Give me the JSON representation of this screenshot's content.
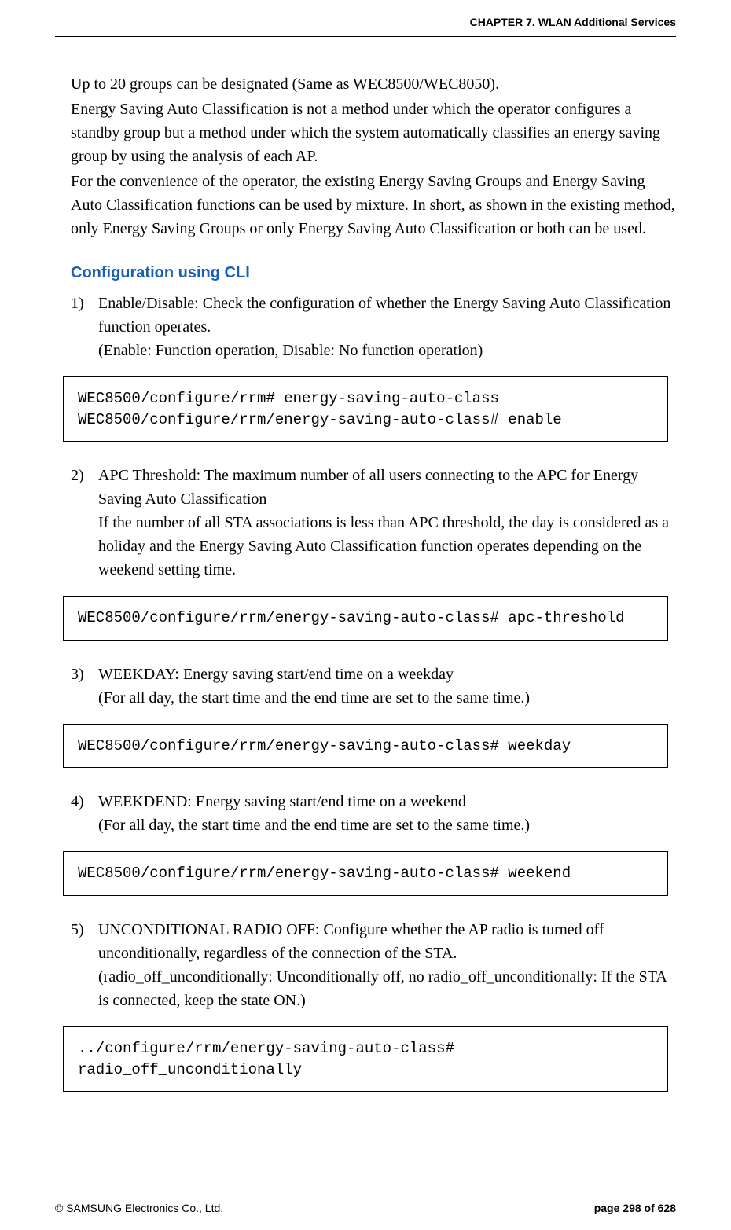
{
  "header": {
    "chapter": "CHAPTER 7. WLAN Additional Services"
  },
  "intro": {
    "para1": "Up to 20 groups can be designated (Same as WEC8500/WEC8050).",
    "para2": "Energy Saving Auto Classification is not a method under which the operator configures a standby group but a method under which the system automatically classifies an energy saving group by using the analysis of each AP.",
    "para3": "For the convenience of the operator, the existing Energy Saving Groups and Energy Saving Auto Classification functions can be used by mixture. In short, as shown in the existing method, only Energy Saving Groups or only Energy Saving Auto Classification or both can be used."
  },
  "section": {
    "title": "Configuration using CLI"
  },
  "items": [
    {
      "num": "1)",
      "text": "Enable/Disable: Check the configuration of whether the Energy Saving Auto Classification function operates.",
      "note": "(Enable: Function operation, Disable: No function operation)",
      "code": "WEC8500/configure/rrm# energy-saving-auto-class\nWEC8500/configure/rrm/energy-saving-auto-class# enable"
    },
    {
      "num": "2)",
      "text": "APC Threshold: The maximum number of all users connecting to the APC for Energy Saving Auto Classification",
      "note": "If the number of all STA associations is less than APC threshold, the day is considered as a holiday and the Energy Saving Auto Classification function operates depending on the weekend setting time.",
      "code": "WEC8500/configure/rrm/energy-saving-auto-class# apc-threshold"
    },
    {
      "num": "3)",
      "text": "WEEKDAY: Energy saving start/end time on a weekday",
      "note": "(For all day, the start time and the end time are set to the same time.)",
      "code": "WEC8500/configure/rrm/energy-saving-auto-class# weekday"
    },
    {
      "num": "4)",
      "text": "WEEKDEND: Energy saving start/end time on a weekend",
      "note": "(For all day, the start time and the end time are set to the same time.)",
      "code": "WEC8500/configure/rrm/energy-saving-auto-class# weekend"
    },
    {
      "num": "5)",
      "text": "UNCONDITIONAL RADIO OFF: Configure whether the AP radio is turned off unconditionally, regardless of the connection of the STA.",
      "note": "(radio_off_unconditionally: Unconditionally off, no radio_off_unconditionally: If the STA is connected, keep the state ON.)",
      "code": "../configure/rrm/energy-saving-auto-class# radio_off_unconditionally"
    }
  ],
  "footer": {
    "copyright": "© SAMSUNG Electronics Co., Ltd.",
    "page": "page 298 of 628"
  }
}
